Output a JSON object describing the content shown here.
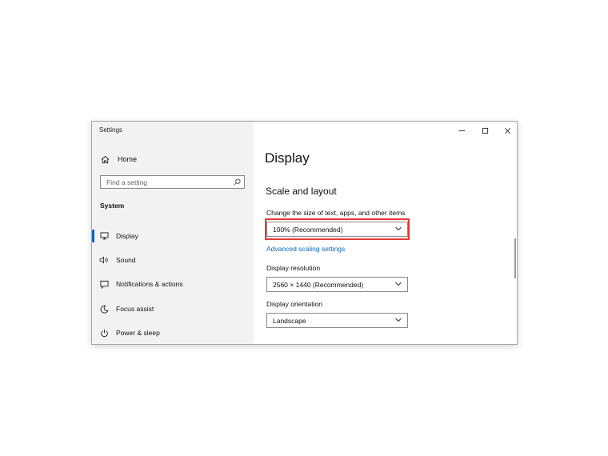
{
  "window": {
    "title": "Settings",
    "controls": {
      "minimize": "minimize-icon",
      "maximize": "maximize-icon",
      "close": "close-icon"
    }
  },
  "sidebar": {
    "home_label": "Home",
    "search_placeholder": "Find a setting",
    "section_label": "System",
    "items": [
      {
        "label": "Display",
        "icon": "monitor-icon",
        "active": true
      },
      {
        "label": "Sound",
        "icon": "speaker-icon",
        "active": false
      },
      {
        "label": "Notifications & actions",
        "icon": "notification-icon",
        "active": false
      },
      {
        "label": "Focus assist",
        "icon": "moon-icon",
        "active": false
      },
      {
        "label": "Power & sleep",
        "icon": "power-icon",
        "active": false
      }
    ]
  },
  "main": {
    "title": "Display",
    "section_title": "Scale and layout",
    "scale": {
      "label": "Change the size of text, apps, and other items",
      "value": "100% (Recommended)"
    },
    "advanced_link": "Advanced scaling settings",
    "resolution": {
      "label": "Display resolution",
      "value": "2560 × 1440 (Recommended)"
    },
    "orientation": {
      "label": "Display orientation",
      "value": "Landscape"
    }
  },
  "colors": {
    "accent": "#0067c0",
    "highlight": "#e53935",
    "sidebar_bg": "#f2f2f2"
  }
}
